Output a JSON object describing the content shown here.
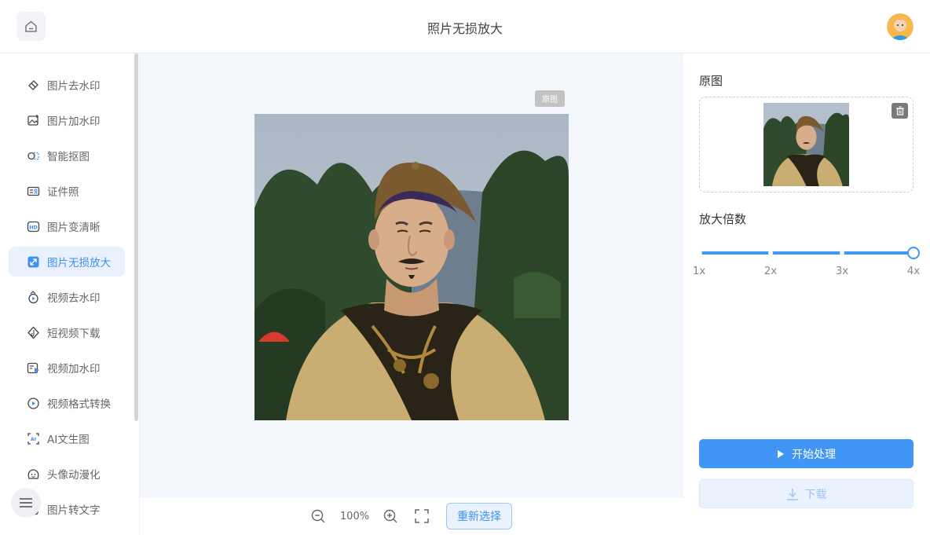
{
  "header": {
    "title": "照片无损放大"
  },
  "sidebar": {
    "items": [
      {
        "label": "图片去水印",
        "icon": "eraser-icon"
      },
      {
        "label": "图片加水印",
        "icon": "image-add-icon"
      },
      {
        "label": "智能抠图",
        "icon": "cutout-icon"
      },
      {
        "label": "证件照",
        "icon": "id-card-icon"
      },
      {
        "label": "图片变清晰",
        "icon": "hd-icon"
      },
      {
        "label": "图片无损放大",
        "icon": "enlarge-icon",
        "active": true
      },
      {
        "label": "视频去水印",
        "icon": "video-eraser-icon"
      },
      {
        "label": "短视频下载",
        "icon": "tiktok-icon"
      },
      {
        "label": "视频加水印",
        "icon": "video-add-icon"
      },
      {
        "label": "视频格式转换",
        "icon": "video-convert-icon"
      },
      {
        "label": "AI文生图",
        "icon": "ai-scan-icon"
      },
      {
        "label": "头像动漫化",
        "icon": "avatar-anime-icon"
      },
      {
        "label": "图片转文字",
        "icon": "image-text-icon"
      }
    ]
  },
  "canvas": {
    "original_tag": "原图"
  },
  "toolbar": {
    "zoom_level": "100%",
    "reselect_label": "重新选择"
  },
  "panel": {
    "original_title": "原图",
    "scale_title": "放大倍数",
    "scale_options": [
      "1x",
      "2x",
      "3x",
      "4x"
    ],
    "scale_selected": "4x",
    "start_label": "开始处理",
    "download_label": "下载"
  },
  "colors": {
    "accent": "#4095f5",
    "active_bg": "#eaf1fc",
    "canvas_bg": "#f3f6fa"
  }
}
